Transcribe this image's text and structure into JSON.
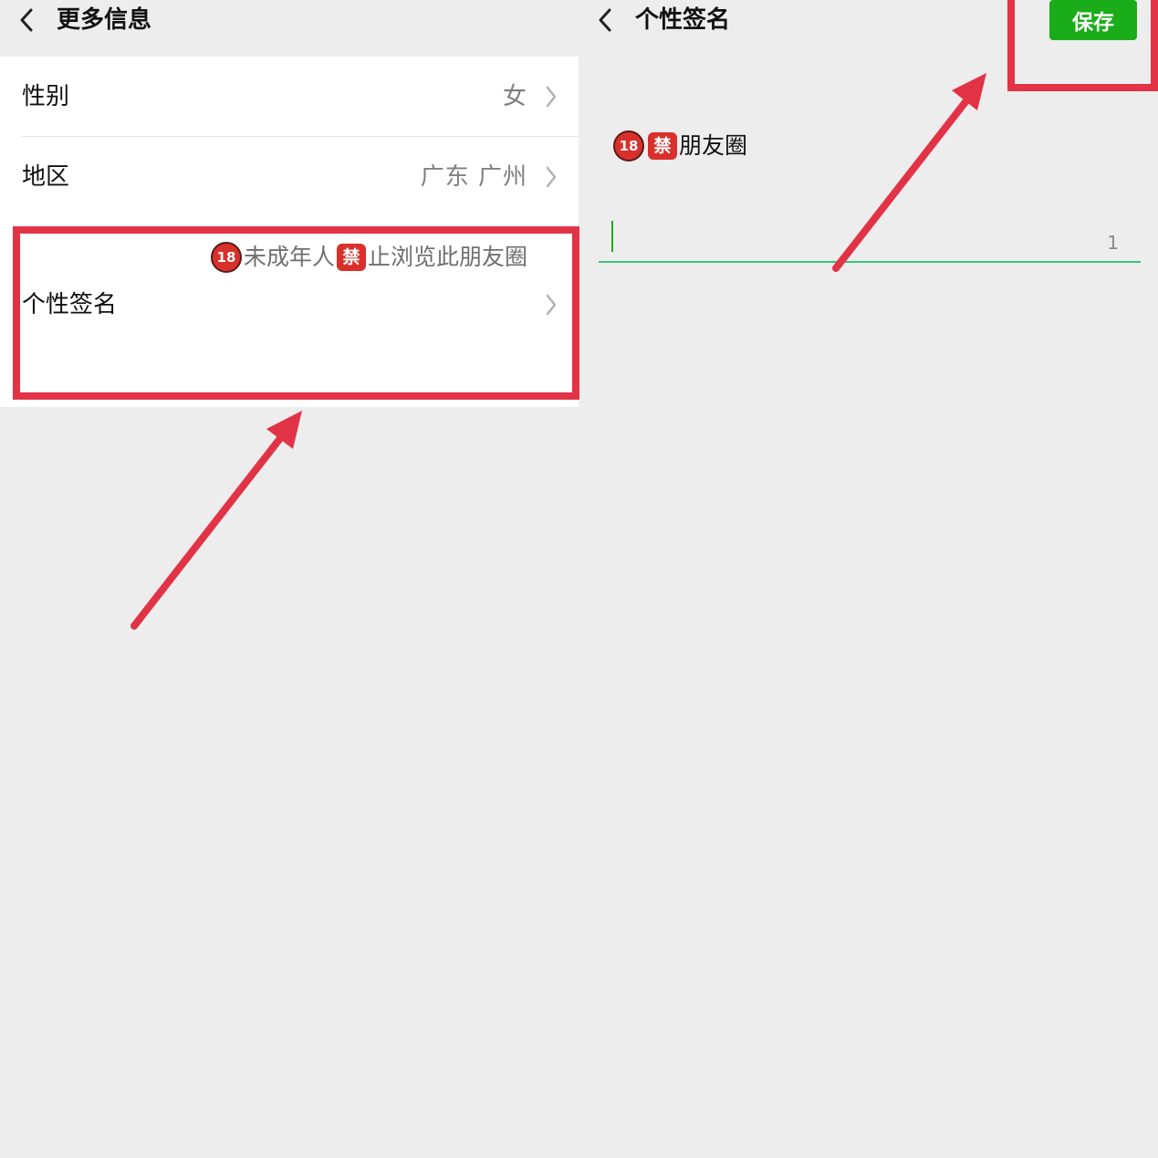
{
  "left_screen": {
    "nav": {
      "title": "更多信息"
    },
    "rows": {
      "gender": {
        "label": "性别",
        "value": "女"
      },
      "region": {
        "label": "地区",
        "value": "广东 广州"
      },
      "signature": {
        "label": "个性签名",
        "badge_18": "18",
        "text_a": "未成年人",
        "badge_ban": "禁",
        "text_b": "止浏览此朋友圈"
      }
    }
  },
  "right_screen": {
    "nav": {
      "title": "个性签名",
      "save_label": "保存"
    },
    "preview": {
      "badge_18": "18",
      "badge_ban": "禁",
      "text": "朋友圈"
    },
    "input": {
      "value": "",
      "count": "1"
    }
  },
  "colors": {
    "accent_green": "#1aad19",
    "highlight_red": "#e23346",
    "background": "#ededed"
  },
  "icons": [
    "chevron-left-icon",
    "chevron-right-icon",
    "arrow-annotation"
  ]
}
